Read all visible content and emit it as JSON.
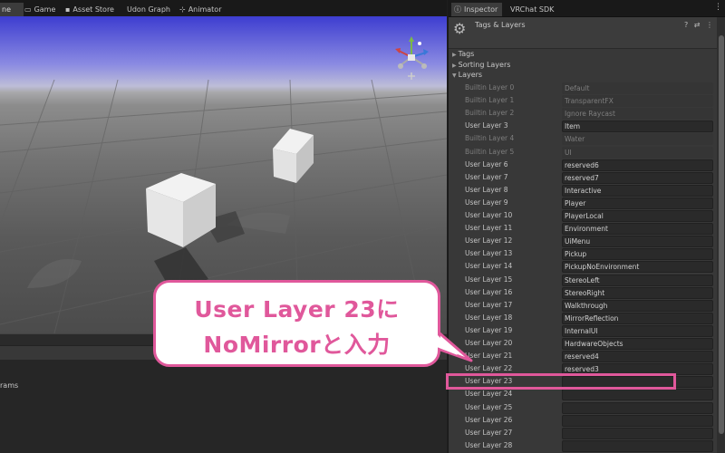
{
  "left_tabs": [
    {
      "label": "ne",
      "icon": "",
      "active": true
    },
    {
      "label": "Game",
      "icon": "game-icon"
    },
    {
      "label": "Asset Store",
      "icon": "asset-store-icon"
    },
    {
      "label": "Udon Graph",
      "icon": ""
    },
    {
      "label": "Animator",
      "icon": "animator-icon"
    }
  ],
  "console": {
    "text": "rams"
  },
  "right_tabs": [
    {
      "label": "Inspector",
      "icon": "info-icon",
      "active": true
    },
    {
      "label": "VRChat SDK",
      "icon": ""
    }
  ],
  "inspector": {
    "title": "Tags & Layers",
    "header_icons": "? ⇄ ⋮",
    "sections": {
      "tags": "Tags",
      "sorting_layers": "Sorting Layers",
      "layers": "Layers"
    }
  },
  "layers": [
    {
      "label": "Builtin Layer 0",
      "value": "Default",
      "disabled": true
    },
    {
      "label": "Builtin Layer 1",
      "value": "TransparentFX",
      "disabled": true
    },
    {
      "label": "Builtin Layer 2",
      "value": "Ignore Raycast",
      "disabled": true
    },
    {
      "label": "User Layer 3",
      "value": "Item",
      "disabled": false
    },
    {
      "label": "Builtin Layer 4",
      "value": "Water",
      "disabled": true
    },
    {
      "label": "Builtin Layer 5",
      "value": "UI",
      "disabled": true
    },
    {
      "label": "User Layer 6",
      "value": "reserved6",
      "disabled": false
    },
    {
      "label": "User Layer 7",
      "value": "reserved7",
      "disabled": false
    },
    {
      "label": "User Layer 8",
      "value": "Interactive",
      "disabled": false
    },
    {
      "label": "User Layer 9",
      "value": "Player",
      "disabled": false
    },
    {
      "label": "User Layer 10",
      "value": "PlayerLocal",
      "disabled": false
    },
    {
      "label": "User Layer 11",
      "value": "Environment",
      "disabled": false
    },
    {
      "label": "User Layer 12",
      "value": "UiMenu",
      "disabled": false
    },
    {
      "label": "User Layer 13",
      "value": "Pickup",
      "disabled": false
    },
    {
      "label": "User Layer 14",
      "value": "PickupNoEnvironment",
      "disabled": false
    },
    {
      "label": "User Layer 15",
      "value": "StereoLeft",
      "disabled": false
    },
    {
      "label": "User Layer 16",
      "value": "StereoRight",
      "disabled": false
    },
    {
      "label": "User Layer 17",
      "value": "Walkthrough",
      "disabled": false
    },
    {
      "label": "User Layer 18",
      "value": "MirrorReflection",
      "disabled": false
    },
    {
      "label": "User Layer 19",
      "value": "InternalUI",
      "disabled": false
    },
    {
      "label": "User Layer 20",
      "value": "HardwareObjects",
      "disabled": false
    },
    {
      "label": "User Layer 21",
      "value": "reserved4",
      "disabled": false
    },
    {
      "label": "User Layer 22",
      "value": "reserved3",
      "disabled": false
    },
    {
      "label": "User Layer 23",
      "value": "",
      "disabled": false
    },
    {
      "label": "User Layer 24",
      "value": "",
      "disabled": false
    },
    {
      "label": "User Layer 25",
      "value": "",
      "disabled": false
    },
    {
      "label": "User Layer 26",
      "value": "",
      "disabled": false
    },
    {
      "label": "User Layer 27",
      "value": "",
      "disabled": false
    },
    {
      "label": "User Layer 28",
      "value": "",
      "disabled": false
    }
  ],
  "callout": {
    "line1": "User Layer 23に",
    "line2": "NoMirrorと入力"
  },
  "colors": {
    "accent": "#e0589b",
    "panel": "#383838",
    "field": "#2a2a2a"
  }
}
